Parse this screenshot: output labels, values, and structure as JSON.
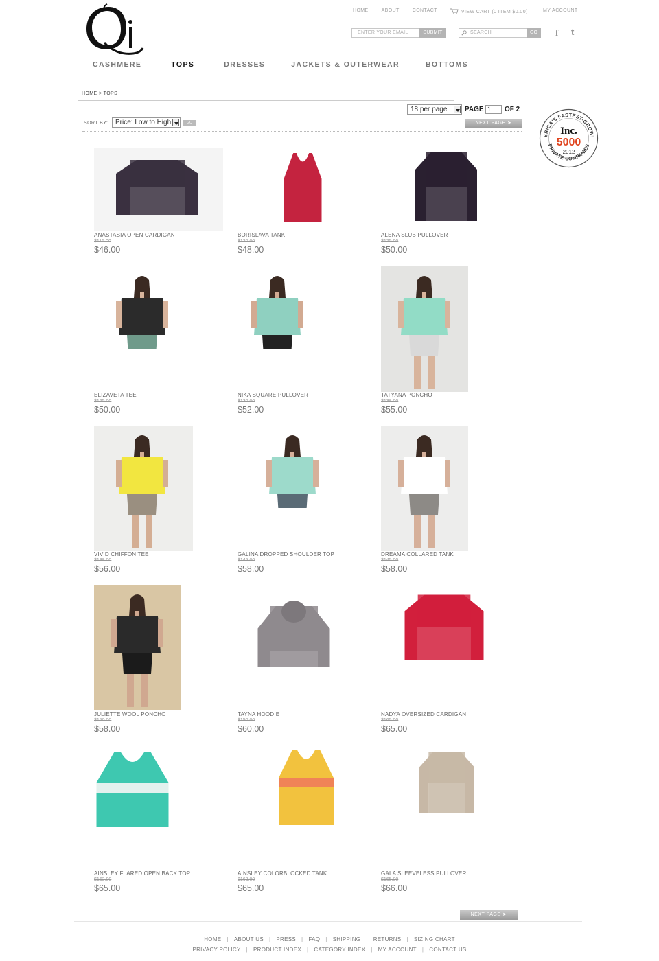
{
  "header": {
    "logo_text": "Qi",
    "top_links": [
      "HOME",
      "ABOUT",
      "CONTACT"
    ],
    "cart_label": "VIEW CART (0 ITEM $0.00)",
    "my_account": "MY ACCOUNT",
    "email_placeholder": "ENTER YOUR EMAIL",
    "submit_label": "SUBMIT",
    "search_placeholder": "SEARCH",
    "search_go": "GO",
    "facebook_icon": "f",
    "twitter_icon": "t"
  },
  "nav": {
    "items": [
      "CASHMERE",
      "TOPS",
      "DRESSES",
      "JACKETS & OUTERWEAR",
      "BOTTOMS"
    ],
    "active": "TOPS"
  },
  "breadcrumb": "HOME > TOPS",
  "toolbar": {
    "per_page": "18 per page",
    "page_label": "PAGE",
    "page_value": "1",
    "of_label": "OF 2",
    "sort_label": "SORT BY:",
    "sort_value": "Price: Low to High",
    "sort_go": "GO",
    "next_page": "NEXT PAGE ➤"
  },
  "badge": {
    "top_text": "AMERICA'S FASTEST-GROWING",
    "brand": "Inc.",
    "number": "5000",
    "year": "2012",
    "bottom_text": "PRIVATE COMPANIES"
  },
  "products": [
    {
      "name": "ANASTASIA OPEN CARDIGAN",
      "old_price": "$115.00",
      "price": "$46.00"
    },
    {
      "name": "BORISLAVA TANK",
      "old_price": "$120.00",
      "price": "$48.00"
    },
    {
      "name": "ALENA SLUB PULLOVER",
      "old_price": "$125.00",
      "price": "$50.00"
    },
    {
      "name": "ELIZAVETA TEE",
      "old_price": "$125.00",
      "price": "$50.00"
    },
    {
      "name": "NIKA SQUARE PULLOVER",
      "old_price": "$130.00",
      "price": "$52.00"
    },
    {
      "name": "TATYANA PONCHO",
      "old_price": "$138.00",
      "price": "$55.00"
    },
    {
      "name": "VIVID CHIFFON TEE",
      "old_price": "$138.00",
      "price": "$56.00"
    },
    {
      "name": "GALINA DROPPED SHOULDER TOP",
      "old_price": "$145.00",
      "price": "$58.00"
    },
    {
      "name": "DREAMA COLLARED TANK",
      "old_price": "$145.00",
      "price": "$58.00"
    },
    {
      "name": "JULIETTE WOOL PONCHO",
      "old_price": "$150.00",
      "price": "$58.00"
    },
    {
      "name": "TAYNA HOODIE",
      "old_price": "$150.00",
      "price": "$60.00"
    },
    {
      "name": "NADYA OVERSIZED CARDIGAN",
      "old_price": "$165.00",
      "price": "$65.00"
    },
    {
      "name": "AINSLEY FLARED OPEN BACK TOP",
      "old_price": "$163.00",
      "price": "$65.00"
    },
    {
      "name": "AINSLEY COLORBLOCKED TANK",
      "old_price": "$163.00",
      "price": "$65.00"
    },
    {
      "name": "GALA SLEEVELESS PULLOVER",
      "old_price": "$165.00",
      "price": "$66.00"
    }
  ],
  "footer": {
    "row1": [
      "HOME",
      "ABOUT US",
      "PRESS",
      "FAQ",
      "SHIPPING",
      "RETURNS",
      "SIZING CHART"
    ],
    "row2": [
      "PRIVACY POLICY",
      "PRODUCT INDEX",
      "CATEGORY INDEX",
      "MY ACCOUNT",
      "CONTACT US"
    ]
  }
}
